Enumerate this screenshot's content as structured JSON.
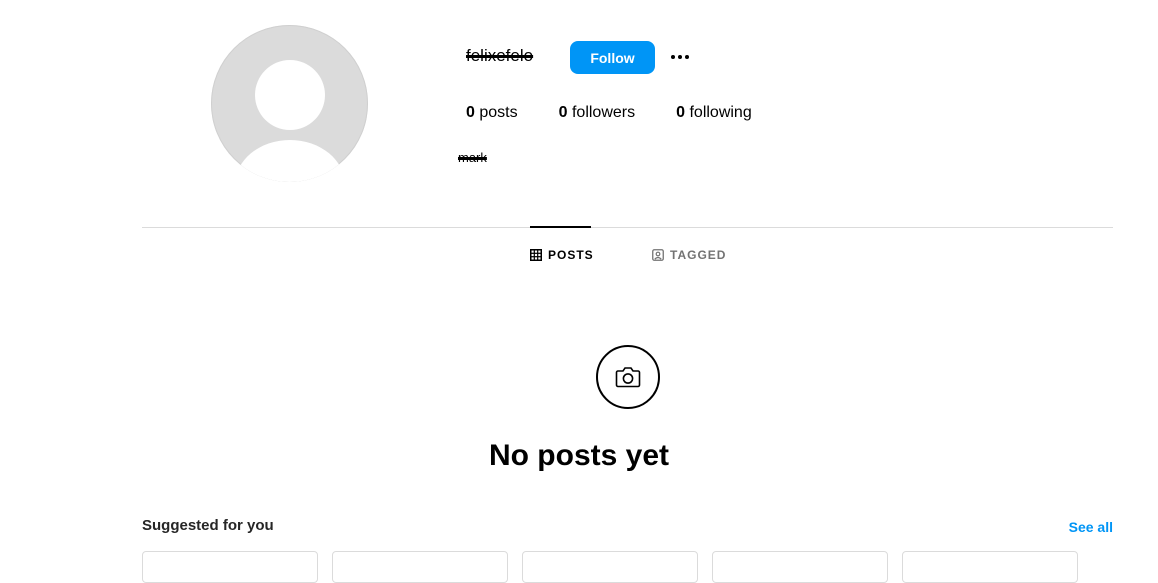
{
  "profile": {
    "username": "felixefelo",
    "full_name": "mark",
    "follow_label": "Follow",
    "stats": {
      "posts_count": "0",
      "posts_label": "posts",
      "followers_count": "0",
      "followers_label": "followers",
      "following_count": "0",
      "following_label": "following"
    }
  },
  "tabs": [
    {
      "label": "POSTS",
      "active": true,
      "icon": "grid-icon"
    },
    {
      "label": "TAGGED",
      "active": false,
      "icon": "tag-icon"
    }
  ],
  "empty_state": {
    "icon": "camera-icon",
    "title": "No posts yet"
  },
  "suggested": {
    "title": "Suggested for you",
    "see_all_label": "See all"
  },
  "colors": {
    "accent": "#0095f6",
    "divider": "#dbdbdb",
    "muted": "#737373"
  }
}
